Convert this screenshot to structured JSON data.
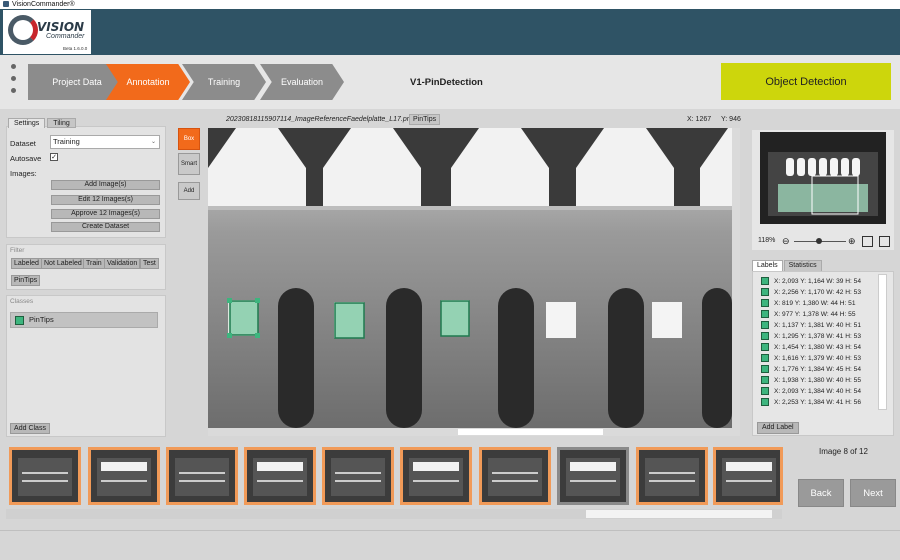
{
  "window": {
    "title": "VisionCommander®"
  },
  "logo": {
    "line1": "VISION",
    "line2": "Commander",
    "version": "Beta 1.6.0.0"
  },
  "workflow": {
    "steps": [
      "Project Data",
      "Annotation",
      "Training",
      "Evaluation"
    ],
    "active": "Annotation"
  },
  "project": {
    "title": "V1-PinDetection"
  },
  "mode_button": {
    "label": "Object Detection"
  },
  "left": {
    "tabs": [
      "Settings",
      "Tiling"
    ],
    "dataset_label": "Dataset",
    "dataset_value": "Training",
    "autosave_label": "Autosave",
    "images_label": "Images:",
    "buttons": [
      "Add Image(s)",
      "Edit 12 Images(s)",
      "Approve 12 Images(s)",
      "Create Dataset"
    ],
    "filter_title": "Filter",
    "filters": [
      "Labeled",
      "Not Labeled",
      "Train",
      "Validation",
      "Test",
      "PinTips"
    ],
    "classes_title": "Classes",
    "class_name": "PinTips",
    "add_class": "Add Class"
  },
  "tools": [
    "Box",
    "Smart",
    "Add"
  ],
  "viewer": {
    "image_name": "20230818115907114_ImageReferenceFaedelplatte_L17.png",
    "class_tag": "PinTips",
    "x": "X: 1267",
    "y": "Y: 946"
  },
  "zoom": {
    "label": "118%",
    "level_fraction": 0.5
  },
  "labels_tabs": [
    "Labels",
    "Statistics"
  ],
  "labels": [
    "X: 2,093 Y: 1,164 W: 39 H: 54",
    "X: 2,256 Y: 1,170 W: 42 H: 53",
    "X: 819 Y: 1,380 W: 44 H: 51",
    "X: 977 Y: 1,378 W: 44 H: 55",
    "X: 1,137 Y: 1,381 W: 40 H: 51",
    "X: 1,295 Y: 1,378 W: 41 H: 53",
    "X: 1,454 Y: 1,380 W: 43 H: 54",
    "X: 1,616 Y: 1,379 W: 40 H: 53",
    "X: 1,776 Y: 1,384 W: 45 H: 54",
    "X: 1,938 Y: 1,380 W: 40 H: 55",
    "X: 2,093 Y: 1,384 W: 40 H: 54",
    "X: 2,253 Y: 1,384 W: 41 H: 56"
  ],
  "add_label": "Add Label",
  "pager": {
    "text": "Image 8 of 12",
    "back": "Back",
    "next": "Next"
  },
  "colors": {
    "accent": "#f26a1b",
    "mode": "#cdd60c",
    "header": "#2f5365",
    "label": "#3db57e"
  }
}
